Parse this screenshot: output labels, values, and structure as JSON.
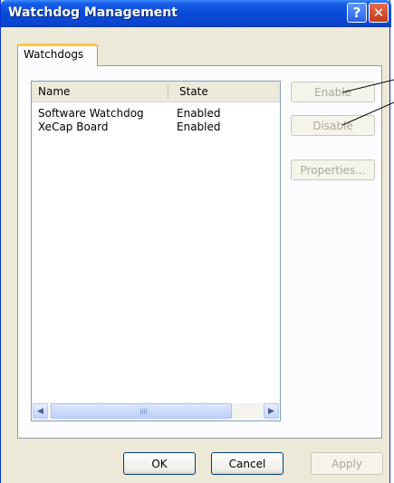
{
  "window": {
    "title": "Watchdog Management"
  },
  "titlebar": {
    "help_glyph": "?",
    "close_glyph": "✕"
  },
  "tabs": [
    {
      "label": "Watchdogs",
      "selected": true
    }
  ],
  "list": {
    "columns": [
      "Name",
      "State"
    ],
    "rows": [
      {
        "name": "Software Watchdog",
        "state": "Enabled"
      },
      {
        "name": "XeCap Board",
        "state": "Enabled"
      }
    ]
  },
  "side_buttons": {
    "enable": "Enable",
    "disable": "Disable",
    "properties": "Properties..."
  },
  "dialog_buttons": {
    "ok": "OK",
    "cancel": "Cancel",
    "apply": "Apply"
  },
  "scrollbar": {
    "left_glyph": "◀",
    "right_glyph": "▶"
  }
}
